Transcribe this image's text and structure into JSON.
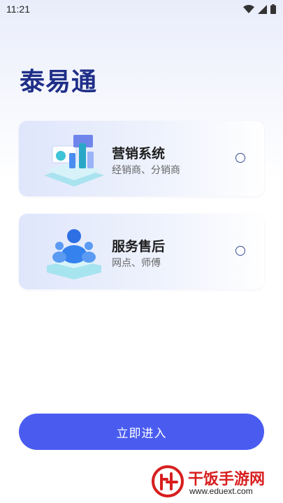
{
  "status_bar": {
    "time": "11:21"
  },
  "app": {
    "title": "泰易通"
  },
  "options": [
    {
      "title": "营销系统",
      "subtitle": "经销商、分销商"
    },
    {
      "title": "服务售后",
      "subtitle": "网点、师傅"
    }
  ],
  "enter_button": {
    "label": "立即进入"
  },
  "watermark": {
    "name": "干饭手游网",
    "url": "www.eduext.com"
  },
  "colors": {
    "primary": "#4a5cf0",
    "title": "#1f2f88",
    "watermark": "#d81e1e"
  }
}
